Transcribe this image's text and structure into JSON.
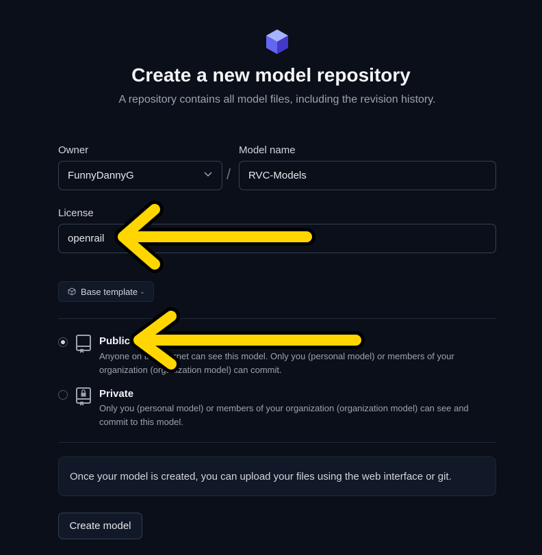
{
  "header": {
    "title": "Create a new model repository",
    "subtitle": "A repository contains all model files, including the revision history."
  },
  "form": {
    "owner": {
      "label": "Owner",
      "value": "FunnyDannyG"
    },
    "separator": "/",
    "model_name": {
      "label": "Model name",
      "value": "RVC-Models"
    },
    "license": {
      "label": "License",
      "value": "openrail"
    },
    "template_button": {
      "label": "Base template"
    }
  },
  "visibility": {
    "options": [
      {
        "title": "Public",
        "description": "Anyone on the internet can see this model. Only you (personal model) or members of your organization (organization model) can commit.",
        "checked": true
      },
      {
        "title": "Private",
        "description": "Only you (personal model) or members of your organization (organization model) can see and commit to this model.",
        "checked": false
      }
    ]
  },
  "info": {
    "text": "Once your model is created, you can upload your files using the web interface or git."
  },
  "actions": {
    "create_label": "Create model"
  },
  "annotations": {
    "arrow_color": "#ffd600"
  },
  "colors": {
    "background": "#0b0f19",
    "border": "#374151",
    "logo_top": "#a5b4fc",
    "logo_side": "#4f46e5"
  }
}
